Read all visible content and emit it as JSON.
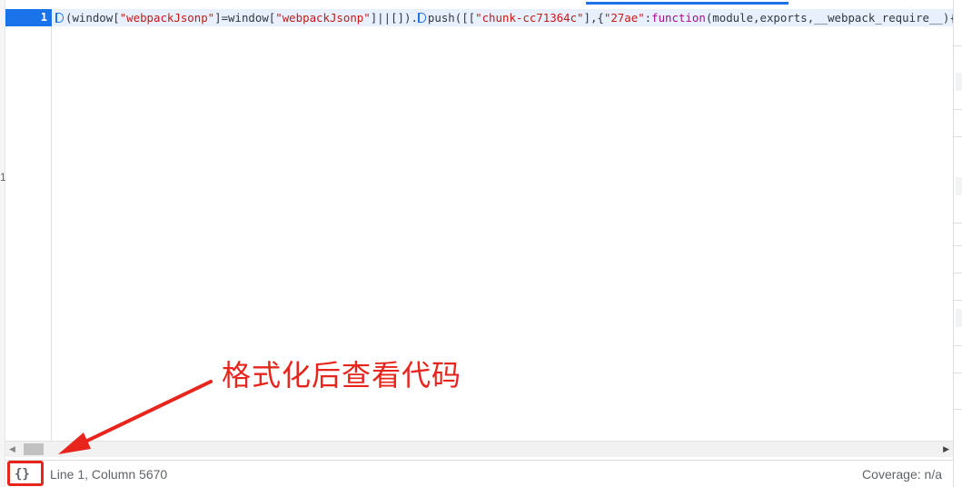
{
  "editor": {
    "line_number": "1",
    "code_tokens": [
      {
        "t": "marker"
      },
      {
        "t": "plain",
        "v": "(window["
      },
      {
        "t": "str",
        "v": "\"webpackJsonp\""
      },
      {
        "t": "plain",
        "v": "]=window["
      },
      {
        "t": "str",
        "v": "\"webpackJsonp\""
      },
      {
        "t": "plain",
        "v": "]||[])."
      },
      {
        "t": "marker"
      },
      {
        "t": "plain",
        "v": "push([["
      },
      {
        "t": "str",
        "v": "\"chunk-cc71364c\""
      },
      {
        "t": "plain",
        "v": "],{"
      },
      {
        "t": "str",
        "v": "\"27ae\""
      },
      {
        "t": "plain",
        "v": ":"
      },
      {
        "t": "key",
        "v": "function"
      },
      {
        "t": "plain",
        "v": "(module,exports,__webpack_require__){"
      }
    ]
  },
  "status": {
    "format_label": "{}",
    "cursor_position": "Line 1, Column 5670",
    "coverage": "Coverage: n/a"
  },
  "annotation": {
    "text": "格式化后查看代码",
    "color": "#e8251c"
  },
  "left_edge_mark": "1",
  "colors": {
    "accent": "#1a73e8",
    "line_highlight": "#e8f0fe",
    "string": "#c41a16",
    "keyword": "#aa0d91"
  }
}
